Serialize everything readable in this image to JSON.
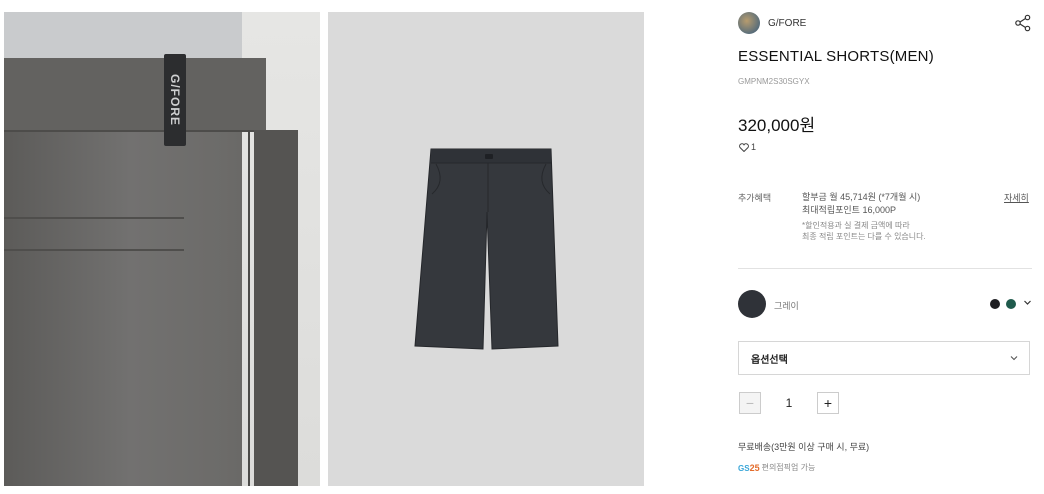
{
  "brand": {
    "name": "G/FORE",
    "tab_text": "G/FORE"
  },
  "product": {
    "title": "ESSENTIAL SHORTS(MEN)",
    "code": "GMPNM2S30SGYX",
    "price": "320,000원",
    "likes": "1"
  },
  "benefit": {
    "label": "추가혜택",
    "installment": "할부금 월 45,714원 (*7개월 시)",
    "points": "최대적립포인트 16,000P",
    "note_line1": "*할인적용과 실 결제 금액에 따라",
    "note_line2": "최종 적립 포인트는 다를 수 있습니다.",
    "detail_link": "자세히"
  },
  "color": {
    "selected_name": "그레이",
    "selected_hex": "#2f3238",
    "options": [
      {
        "hex": "#1e1f22"
      },
      {
        "hex": "#1f5a4c"
      }
    ]
  },
  "option_select": {
    "label": "옵션선택"
  },
  "quantity": {
    "value": "1",
    "minus": "−",
    "plus": "+"
  },
  "shipping": {
    "text": "무료배송(3만원 이상 구매 시, 무료)"
  },
  "pickup": {
    "logo_gs": "GS",
    "logo_num": "25",
    "text": "편의점픽업 가능"
  },
  "icons": {
    "share": "share-icon",
    "heart": "heart-icon",
    "chevron": "chevron-down-icon"
  }
}
